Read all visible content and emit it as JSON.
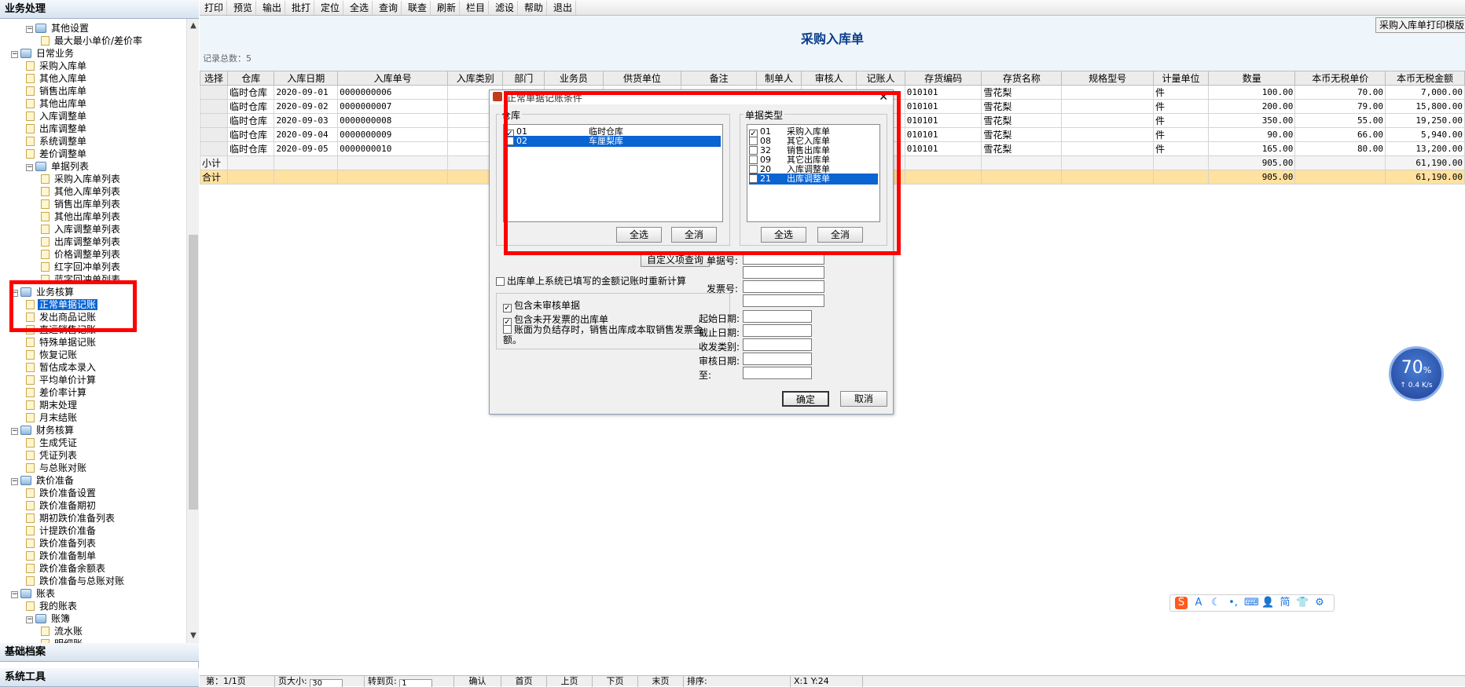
{
  "left_panel": {
    "header": "业务处理",
    "bottom_headers": [
      "基础档案",
      "系统工具"
    ],
    "tree": [
      {
        "level": 1,
        "type": "folder",
        "label": "其他设置",
        "expander": "−"
      },
      {
        "level": 2,
        "type": "doc",
        "label": "最大最小单价/差价率"
      },
      {
        "level": 0,
        "type": "folder",
        "label": "日常业务",
        "expander": "−"
      },
      {
        "level": 1,
        "type": "doc",
        "label": "采购入库单"
      },
      {
        "level": 1,
        "type": "doc",
        "label": "其他入库单"
      },
      {
        "level": 1,
        "type": "doc",
        "label": "销售出库单"
      },
      {
        "level": 1,
        "type": "doc",
        "label": "其他出库单"
      },
      {
        "level": 1,
        "type": "doc",
        "label": "入库调整单"
      },
      {
        "level": 1,
        "type": "doc",
        "label": "出库调整单"
      },
      {
        "level": 1,
        "type": "doc",
        "label": "系统调整单"
      },
      {
        "level": 1,
        "type": "doc",
        "label": "差价调整单"
      },
      {
        "level": 1,
        "type": "folder",
        "label": "单据列表",
        "expander": "−"
      },
      {
        "level": 2,
        "type": "doc",
        "label": "采购入库单列表"
      },
      {
        "level": 2,
        "type": "doc",
        "label": "其他入库单列表"
      },
      {
        "level": 2,
        "type": "doc",
        "label": "销售出库单列表"
      },
      {
        "level": 2,
        "type": "doc",
        "label": "其他出库单列表"
      },
      {
        "level": 2,
        "type": "doc",
        "label": "入库调整单列表"
      },
      {
        "level": 2,
        "type": "doc",
        "label": "出库调整单列表"
      },
      {
        "level": 2,
        "type": "doc",
        "label": "价格调整单列表"
      },
      {
        "level": 2,
        "type": "doc",
        "label": "红字回冲单列表"
      },
      {
        "level": 2,
        "type": "doc",
        "label": "蓝字回冲单列表"
      },
      {
        "level": 0,
        "type": "folder",
        "label": "业务核算",
        "expander": "−"
      },
      {
        "level": 1,
        "type": "doc",
        "label": "正常单据记账",
        "selected": true
      },
      {
        "level": 1,
        "type": "doc",
        "label": "发出商品记账"
      },
      {
        "level": 1,
        "type": "doc",
        "label": "直运销售记账"
      },
      {
        "level": 1,
        "type": "doc",
        "label": "特殊单据记账"
      },
      {
        "level": 1,
        "type": "doc",
        "label": "恢复记账"
      },
      {
        "level": 1,
        "type": "doc",
        "label": "暂估成本录入"
      },
      {
        "level": 1,
        "type": "doc",
        "label": "平均单价计算"
      },
      {
        "level": 1,
        "type": "doc",
        "label": "差价率计算"
      },
      {
        "level": 1,
        "type": "doc",
        "label": "期末处理"
      },
      {
        "level": 1,
        "type": "doc",
        "label": "月末结账"
      },
      {
        "level": 0,
        "type": "folder",
        "label": "财务核算",
        "expander": "−"
      },
      {
        "level": 1,
        "type": "doc",
        "label": "生成凭证"
      },
      {
        "level": 1,
        "type": "doc",
        "label": "凭证列表"
      },
      {
        "level": 1,
        "type": "doc",
        "label": "与总账对账"
      },
      {
        "level": 0,
        "type": "folder",
        "label": "跌价准备",
        "expander": "−"
      },
      {
        "level": 1,
        "type": "doc",
        "label": "跌价准备设置"
      },
      {
        "level": 1,
        "type": "doc",
        "label": "跌价准备期初"
      },
      {
        "level": 1,
        "type": "doc",
        "label": "期初跌价准备列表"
      },
      {
        "level": 1,
        "type": "doc",
        "label": "计提跌价准备"
      },
      {
        "level": 1,
        "type": "doc",
        "label": "跌价准备列表"
      },
      {
        "level": 1,
        "type": "doc",
        "label": "跌价准备制单"
      },
      {
        "level": 1,
        "type": "doc",
        "label": "跌价准备余额表"
      },
      {
        "level": 1,
        "type": "doc",
        "label": "跌价准备与总账对账"
      },
      {
        "level": 0,
        "type": "folder",
        "label": "账表",
        "expander": "−"
      },
      {
        "level": 1,
        "type": "doc",
        "label": "我的账表"
      },
      {
        "level": 1,
        "type": "folder",
        "label": "账簿",
        "expander": "−"
      },
      {
        "level": 2,
        "type": "doc",
        "label": "流水账"
      },
      {
        "level": 2,
        "type": "doc",
        "label": "明细账"
      }
    ]
  },
  "toolbar": [
    "打印",
    "预览",
    "输出",
    "批打",
    "定位",
    "全选",
    "查询",
    "联查",
    "刷新",
    "栏目",
    "滤设",
    "帮助",
    "退出"
  ],
  "document": {
    "title": "采购入库单",
    "record_count": "记录总数：5",
    "print_template_button": "采购入库单打印模版"
  },
  "grid": {
    "columns": [
      "选择",
      "仓库",
      "入库日期",
      "入库单号",
      "入库类别",
      "部门",
      "业务员",
      "供货单位",
      "备注",
      "制单人",
      "审核人",
      "记账人",
      "存货编码",
      "存货名称",
      "规格型号",
      "计量单位",
      "数量",
      "本币无税单价",
      "本币无税金额"
    ],
    "rows": [
      [
        "",
        "临时仓库",
        "2020-09-01",
        "0000000006",
        "",
        "",
        "",
        "",
        "",
        "",
        "",
        "",
        "010101",
        "雪花梨",
        "",
        "件",
        "100.00",
        "70.00",
        "7,000.00"
      ],
      [
        "",
        "临时仓库",
        "2020-09-02",
        "0000000007",
        "",
        "",
        "",
        "",
        "",
        "",
        "",
        "",
        "010101",
        "雪花梨",
        "",
        "件",
        "200.00",
        "79.00",
        "15,800.00"
      ],
      [
        "",
        "临时仓库",
        "2020-09-03",
        "0000000008",
        "",
        "",
        "",
        "",
        "",
        "",
        "",
        "",
        "010101",
        "雪花梨",
        "",
        "件",
        "350.00",
        "55.00",
        "19,250.00"
      ],
      [
        "",
        "临时仓库",
        "2020-09-04",
        "0000000009",
        "",
        "",
        "",
        "",
        "",
        "",
        "",
        "",
        "010101",
        "雪花梨",
        "",
        "件",
        "90.00",
        "66.00",
        "5,940.00"
      ],
      [
        "",
        "临时仓库",
        "2020-09-05",
        "0000000010",
        "",
        "",
        "",
        "",
        "",
        "",
        "",
        "",
        "010101",
        "雪花梨",
        "",
        "件",
        "165.00",
        "80.00",
        "13,200.00"
      ]
    ],
    "subtotal": {
      "label": "小计",
      "quantity": "905.00",
      "amount": "61,190.00"
    },
    "total": {
      "label": "合计",
      "quantity": "905.00",
      "amount": "61,190.00"
    }
  },
  "statusbar": {
    "page": "第：1/1页",
    "page_size_label": "页大小:",
    "page_size_value": "30",
    "goto_label": "转到页:",
    "goto_value": "1",
    "confirm": "确认",
    "first": "首页",
    "prev": "上页",
    "next": "下页",
    "last": "末页",
    "sort_label": "排序:",
    "coords": "X:1 Y:24"
  },
  "dialog": {
    "title": "正常单据记账条件",
    "warehouse_group": "仓库",
    "warehouses": [
      {
        "code": "01",
        "name": "临时仓库",
        "checked": true,
        "selected": false
      },
      {
        "code": "02",
        "name": "车厘梨库",
        "checked": false,
        "selected": true
      }
    ],
    "doc_type_group": "单据类型",
    "doc_types": [
      {
        "code": "01",
        "name": "采购入库单",
        "checked": true,
        "selected": false
      },
      {
        "code": "08",
        "name": "其它入库单",
        "checked": false,
        "selected": false
      },
      {
        "code": "32",
        "name": "销售出库单",
        "checked": false,
        "selected": false
      },
      {
        "code": "09",
        "name": "其它出库单",
        "checked": false,
        "selected": false
      },
      {
        "code": "20",
        "name": "入库调整单",
        "checked": false,
        "selected": false
      },
      {
        "code": "21",
        "name": "出库调整单",
        "checked": false,
        "selected": true
      }
    ],
    "select_all": "全选",
    "clear_all": "全消",
    "custom_query": "自定义项查询",
    "recalc_check": "出库单上系统已填写的金额记账时重新计算",
    "options": [
      {
        "label": "包含未审核单据",
        "checked": true
      },
      {
        "label": "包含未开发票的出库单",
        "checked": true
      },
      {
        "label": "账面为负结存时，销售出库成本取销售发票金额。",
        "checked": false
      }
    ],
    "fields": [
      "单据号:",
      "发票号:",
      "起始日期:",
      "截止日期:",
      "收发类别:",
      "审核日期:",
      "至:"
    ],
    "ok": "确定",
    "cancel": "取消"
  },
  "speed_widget": {
    "percent": "70",
    "unit": "%",
    "rate": "0.4 K/s"
  },
  "ime_bar": {
    "icons": [
      "sogou-logo-icon",
      "font-icon",
      "moon-icon",
      "punctuation-icon",
      "keyboard-icon",
      "user-icon",
      "simplified-icon",
      "skin-icon",
      "settings-icon"
    ],
    "glyphs": [
      "S",
      "A",
      "☾",
      "•,",
      "⌨",
      "👤",
      "简",
      "👕",
      "⚙"
    ]
  },
  "colors": {
    "selection": "#0a64d2",
    "highlight_box": "#ff0000",
    "total_row": "#ffe1a0",
    "title": "#0a3c8c"
  }
}
